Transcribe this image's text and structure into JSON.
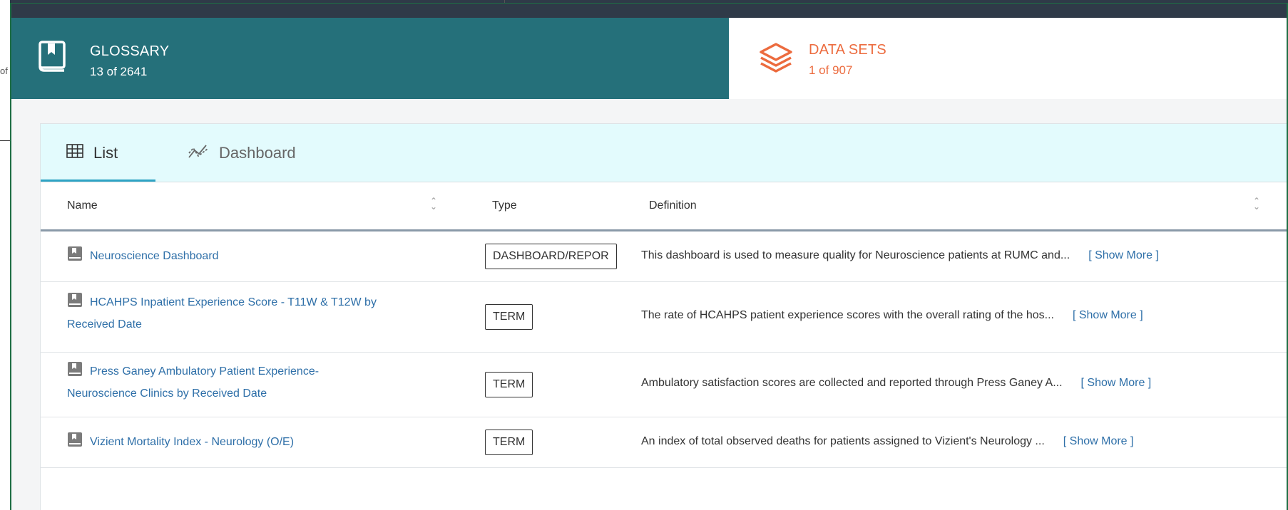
{
  "background": {
    "fragment_text": "of"
  },
  "tiles": {
    "glossary": {
      "title": "GLOSSARY",
      "count": "13 of 2641",
      "icon": "book-icon",
      "color": "#25707a"
    },
    "datasets": {
      "title": "DATA SETS",
      "count": "1 of 907",
      "icon": "layers-icon",
      "color": "#ec6b3e"
    }
  },
  "tabs": {
    "list": {
      "label": "List",
      "icon": "table-icon",
      "active": true
    },
    "dashboard": {
      "label": "Dashboard",
      "icon": "trend-icon",
      "active": false
    }
  },
  "table": {
    "headers": {
      "name": "Name",
      "type": "Type",
      "definition": "Definition"
    },
    "show_more_label": "[ Show More ]",
    "rows": [
      {
        "name": "Neuroscience Dashboard",
        "type": "DASHBOARD/REPOR",
        "definition": "This dashboard is used to measure quality for Neuroscience patients at RUMC and..."
      },
      {
        "name_line1": "HCAHPS Inpatient Experience Score - T11W & T12W by",
        "name_line2": "Received Date",
        "type": "TERM",
        "definition": "The rate of HCAHPS patient experience scores with the overall rating of the hos..."
      },
      {
        "name_line1": "Press Ganey Ambulatory Patient Experience-",
        "name_line2": "Neuroscience Clinics by Received Date",
        "type": "TERM",
        "definition": "Ambulatory satisfaction scores are collected and reported through Press Ganey A..."
      },
      {
        "name": "Vizient Mortality Index - Neurology (O/E)",
        "type": "TERM",
        "definition": "An index of total observed deaths for patients assigned to Vizient's Neurology ..."
      }
    ]
  }
}
